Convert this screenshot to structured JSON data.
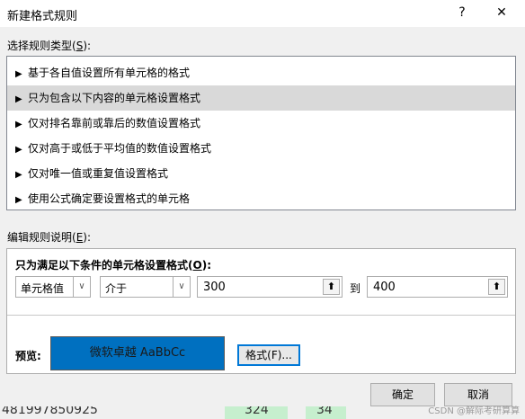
{
  "window": {
    "title": "新建格式规则",
    "help_icon": "?",
    "close_icon": "✕"
  },
  "rule_type": {
    "label_text": "选择规则类型(",
    "label_key": "S",
    "label_tail": "):",
    "items": [
      {
        "label": "基于各自值设置所有单元格的格式"
      },
      {
        "label": "只为包含以下内容的单元格设置格式"
      },
      {
        "label": "仅对排名靠前或靠后的数值设置格式"
      },
      {
        "label": "仅对高于或低于平均值的数值设置格式"
      },
      {
        "label": "仅对唯一值或重复值设置格式"
      },
      {
        "label": "使用公式确定要设置格式的单元格"
      }
    ]
  },
  "description": {
    "label_text": "编辑规则说明(",
    "label_key": "E",
    "label_tail": "):",
    "condition_text": "只为满足以下条件的单元格设置格式(",
    "condition_key": "O",
    "condition_tail": "):",
    "field_select": "单元格值",
    "operator_select": "介于",
    "value_from": "300",
    "to_label": "到",
    "value_to": "400",
    "preview_label": "预览:",
    "preview_text": "微软卓越  AaBbCc",
    "preview_color": "#0070c0",
    "format_button": "格式(F)..."
  },
  "buttons": {
    "ok": "确定",
    "cancel": "取消"
  },
  "background": {
    "text_left": "481997850925",
    "text_mid": "324",
    "text_right": "34"
  },
  "watermark": "CSDN @解际考研算算"
}
